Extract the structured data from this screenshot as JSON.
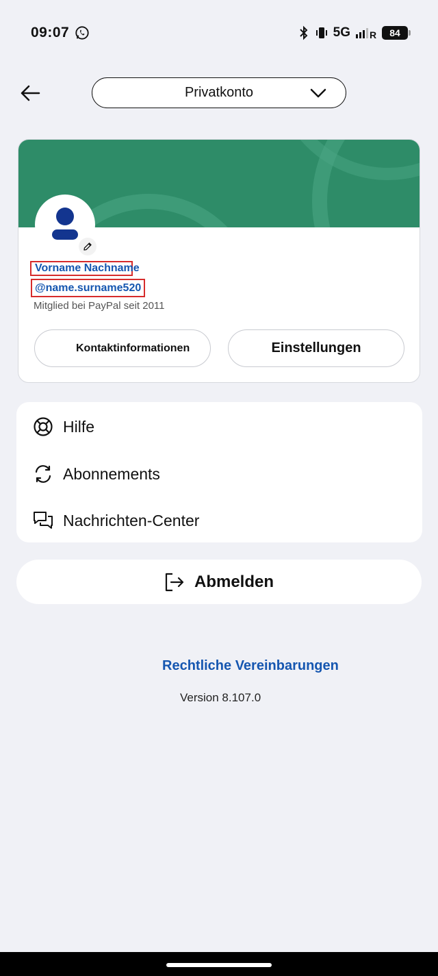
{
  "status_bar": {
    "time": "09:07",
    "network": "5G",
    "battery": "84",
    "icons": [
      "whatsapp-icon",
      "bluetooth-icon",
      "vibrate-icon",
      "signal-icon"
    ]
  },
  "header": {
    "back_icon": "arrow-left-icon",
    "account_selector": "Privatkonto",
    "chevron_icon": "chevron-down-icon"
  },
  "profile": {
    "name": "Vorname Nachname",
    "handle": "@name.surname520",
    "member_since": "Mitglied bei PayPal seit 2011",
    "contact_button": "Kontaktinformationen",
    "settings_button": "Einstellungen",
    "banner_color": "#2e8c68",
    "avatar_color": "#13358f"
  },
  "menu": {
    "items": [
      {
        "label": "Hilfe",
        "icon": "lifebuoy-icon"
      },
      {
        "label": "Abonnements",
        "icon": "refresh-icon"
      },
      {
        "label": "Nachrichten-Center",
        "icon": "chat-bubbles-icon"
      }
    ]
  },
  "logout": {
    "label": "Abmelden",
    "icon": "logout-icon"
  },
  "footer": {
    "legal_link": "Rechtliche Vereinbarungen",
    "version": "Version 8.107.0"
  },
  "colors": {
    "link": "#1556b0",
    "background": "#f0f1f6",
    "highlight_border": "#d62b2b"
  }
}
